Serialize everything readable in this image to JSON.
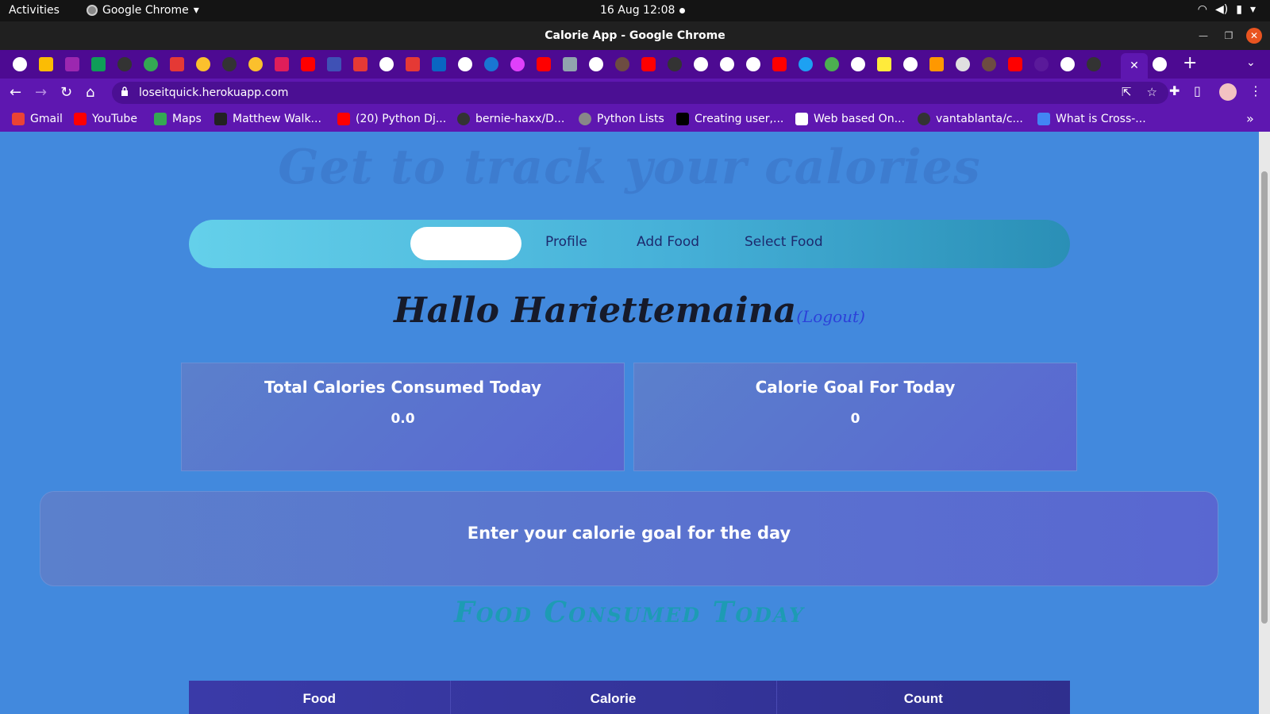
{
  "system_bar": {
    "activities": "Activities",
    "app_name": "Google Chrome",
    "clock": "16 Aug  12:08"
  },
  "window": {
    "title": "Calorie App - Google Chrome"
  },
  "toolbar": {
    "url": "loseitquick.herokuapp.com"
  },
  "bookmarks": [
    {
      "label": "Gmail",
      "icon": "gmail-icon",
      "color": "#ea4335"
    },
    {
      "label": "YouTube",
      "icon": "youtube-icon",
      "color": "#ff0000"
    },
    {
      "label": "Maps",
      "icon": "maps-icon",
      "color": "#34a853"
    },
    {
      "label": "Matthew Walk...",
      "icon": "site-icon",
      "color": "#222222"
    },
    {
      "label": "(20) Python Dj...",
      "icon": "youtube-icon",
      "color": "#ff0000"
    },
    {
      "label": "bernie-haxx/D...",
      "icon": "github-icon",
      "color": "#333333"
    },
    {
      "label": "Python Lists",
      "icon": "globe-icon",
      "color": "#888888"
    },
    {
      "label": "Creating user,...",
      "icon": "medium-icon",
      "color": "#000000"
    },
    {
      "label": "Web based On...",
      "icon": "site-icon",
      "color": "#d93025"
    },
    {
      "label": "vantablanta/c...",
      "icon": "github-icon",
      "color": "#333333"
    },
    {
      "label": "What is Cross-...",
      "icon": "site-icon",
      "color": "#4285f4"
    }
  ],
  "page": {
    "hero_title": "Get to track your calories",
    "nav": {
      "home_label": "",
      "links": [
        "Profile",
        "Add Food",
        "Select Food"
      ]
    },
    "greeting": "Hallo Hariettemaina",
    "logout": "(Logout)",
    "stats": [
      {
        "label": "Total Calories Consumed Today",
        "value": "0.0"
      },
      {
        "label": "Calorie Goal For Today",
        "value": "0"
      }
    ],
    "goal_prompt": "Enter your calorie goal for the day",
    "food_heading": "Food Consumed Today",
    "table_headers": [
      "Food",
      "Calorie",
      "Count"
    ]
  },
  "colors": {
    "page_bg": "#4289dd",
    "tab_bar": "#4d0a92",
    "toolbar": "#5e17b0",
    "accent_logout": "#2c41d9"
  }
}
